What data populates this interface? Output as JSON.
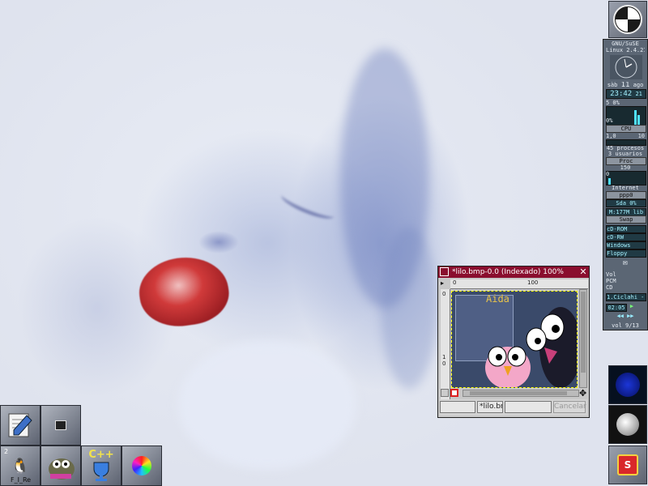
{
  "desktop": {
    "wallpaper": "woman-face-wallpaper"
  },
  "system_monitor": {
    "os_name": "GNU/SuSE",
    "kernel": "Linux 2.4.21",
    "date_day_label": "sàb",
    "date_day": "11",
    "date_month": "ago",
    "time": "23:42",
    "time_seconds": "21",
    "cpu_user_percent": "5 0%",
    "cpu_label": "CPU",
    "cpu_sys_percent": "0%",
    "cpu2_label": "CPU",
    "load_left": "1,0",
    "load_right": "10",
    "processes": "45 procesos",
    "users": "3 usuarios",
    "proc_label": "Proc",
    "net_value": "150",
    "net_zero": "0",
    "internet_label": "Internet",
    "ppp_label": "ppp0",
    "disk_label": "Sda 0%",
    "mem_label": "M:177M lib",
    "swap_label": "Swap",
    "mount_cdrom": "cD-ROM",
    "mount_cdrw": "cD-RW",
    "mount_windows": "Windows",
    "mount_floppy": "Floppy",
    "vol_label": "Vol",
    "pcm_label": "PCM",
    "cd_label": "CD",
    "track": "1.Ciclahi - T",
    "player_time": "02:05",
    "player_footer": "vol 9/13",
    "colors": {
      "panel": "#5b6674",
      "lcd": "#203a44",
      "led": "#a5f2ff"
    }
  },
  "gimp_window": {
    "title": "*lilo.bmp-0.0 (Indexado) 100%",
    "close_glyph": "✕",
    "ruler_h_marks": [
      "0",
      "100"
    ],
    "ruler_v_marks": [
      "0",
      "1",
      "0"
    ],
    "image_text": "Aida",
    "filename_field": "*lilo.br",
    "cancel_label": "Cancelar",
    "title_color": "#8a0e2e"
  },
  "bottom_dock": {
    "workspace_number": "2",
    "workspace_label": "F_I_Re",
    "cpp_label": "C++"
  }
}
